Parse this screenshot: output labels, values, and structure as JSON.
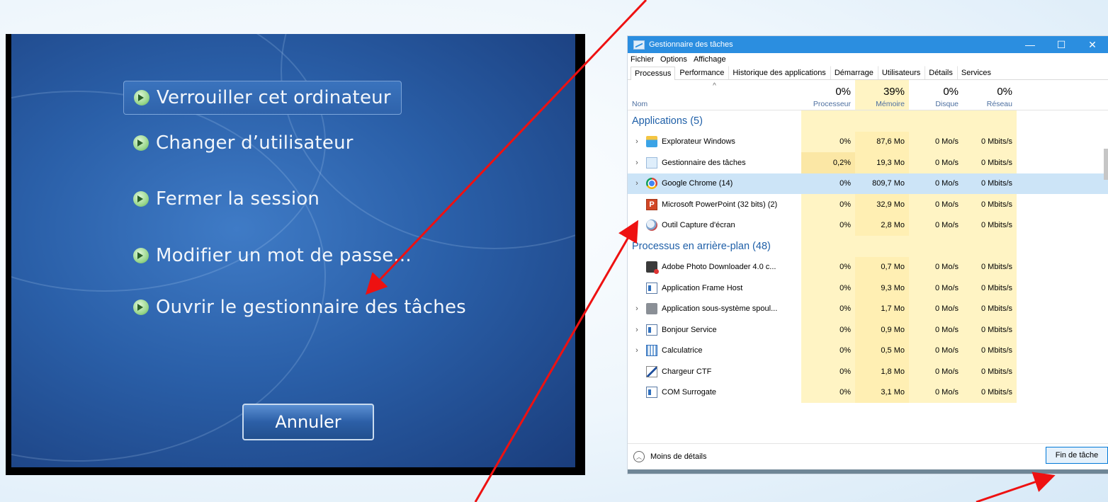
{
  "ctrl_alt_del": {
    "items": [
      {
        "label": "Verrouiller cet ordinateur"
      },
      {
        "label": "Changer d’utilisateur"
      },
      {
        "label": "Fermer la session"
      },
      {
        "label": "Modifier un mot de passe..."
      },
      {
        "label": "Ouvrir le gestionnaire des tâches"
      }
    ],
    "cancel_label": "Annuler"
  },
  "task_manager": {
    "title": "Gestionnaire des tâches",
    "window_buttons": {
      "minimize": "—",
      "maximize": "☐",
      "close": "✕"
    },
    "menu": [
      "Fichier",
      "Options",
      "Affichage"
    ],
    "tabs": [
      "Processus",
      "Performance",
      "Historique des applications",
      "Démarrage",
      "Utilisateurs",
      "Détails",
      "Services"
    ],
    "active_tab": "Processus",
    "columns": {
      "name": "Nom",
      "sort_indicator": "^",
      "cpu": {
        "percent": "0%",
        "label": "Processeur"
      },
      "memory": {
        "percent": "39%",
        "label": "Mémoire"
      },
      "disk": {
        "percent": "0%",
        "label": "Disque"
      },
      "network": {
        "percent": "0%",
        "label": "Réseau"
      }
    },
    "groups": [
      {
        "label": "Applications (5)",
        "rows": [
          {
            "name": "Explorateur Windows",
            "icon": "explorer-icon",
            "cpu": "0%",
            "mem": "87,6 Mo",
            "disk": "0 Mo/s",
            "net": "0 Mbits/s"
          },
          {
            "name": "Gestionnaire des tâches",
            "icon": "task-manager-icon",
            "cpu": "0,2%",
            "mem": "19,3 Mo",
            "disk": "0 Mo/s",
            "net": "0 Mbits/s"
          },
          {
            "name": "Google Chrome (14)",
            "icon": "chrome-icon",
            "cpu": "0%",
            "mem": "809,7 Mo",
            "disk": "0 Mo/s",
            "net": "0 Mbits/s"
          },
          {
            "name": "Microsoft PowerPoint (32 bits) (2)",
            "icon": "powerpoint-icon",
            "cpu": "0%",
            "mem": "32,9 Mo",
            "disk": "0 Mo/s",
            "net": "0 Mbits/s"
          },
          {
            "name": "Outil Capture d'écran",
            "icon": "snipping-tool-icon",
            "cpu": "0%",
            "mem": "2,8 Mo",
            "disk": "0 Mo/s",
            "net": "0 Mbits/s"
          }
        ]
      },
      {
        "label": "Processus en arrière-plan (48)",
        "rows": [
          {
            "name": "Adobe Photo Downloader 4.0 c...",
            "icon": "adobe-icon",
            "cpu": "0%",
            "mem": "0,7 Mo",
            "disk": "0 Mo/s",
            "net": "0 Mbits/s"
          },
          {
            "name": "Application Frame Host",
            "icon": "app-frame-icon",
            "cpu": "0%",
            "mem": "9,3 Mo",
            "disk": "0 Mo/s",
            "net": "0 Mbits/s"
          },
          {
            "name": "Application sous-système spoul...",
            "icon": "printer-icon",
            "cpu": "0%",
            "mem": "1,7 Mo",
            "disk": "0 Mo/s",
            "net": "0 Mbits/s"
          },
          {
            "name": "Bonjour Service",
            "icon": "service-icon",
            "cpu": "0%",
            "mem": "0,9 Mo",
            "disk": "0 Mo/s",
            "net": "0 Mbits/s"
          },
          {
            "name": "Calculatrice",
            "icon": "calculator-icon",
            "cpu": "0%",
            "mem": "0,5 Mo",
            "disk": "0 Mo/s",
            "net": "0 Mbits/s"
          },
          {
            "name": "Chargeur CTF",
            "icon": "ctf-icon",
            "cpu": "0%",
            "mem": "1,8 Mo",
            "disk": "0 Mo/s",
            "net": "0 Mbits/s"
          },
          {
            "name": "COM Surrogate",
            "icon": "com-surrogate-icon",
            "cpu": "0%",
            "mem": "3,1 Mo",
            "disk": "0 Mo/s",
            "net": "0 Mbits/s"
          }
        ]
      }
    ],
    "footer": {
      "less_details": "Moins de détails",
      "end_task": "Fin de tâche"
    }
  },
  "colors": {
    "annotation_arrow": "#ee1111",
    "titlebar": "#2b8ee0",
    "heat_cell": "#fff4c4",
    "selected_row": "#cce4f7"
  }
}
